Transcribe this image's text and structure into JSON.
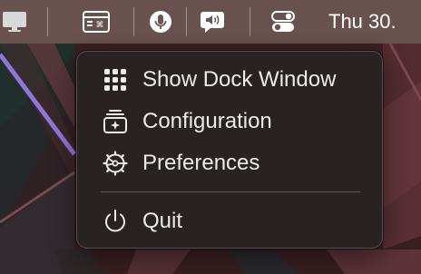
{
  "menubar": {
    "icons": [
      "display-icon",
      "keyboard-shortcut-icon",
      "microphone-icon",
      "speech-bubble-speaker-icon",
      "control-center-toggles-icon"
    ],
    "clock": "Thu 30."
  },
  "menu": {
    "items": [
      {
        "label": "Show Dock Window",
        "icon": "grid-icon"
      },
      {
        "label": "Configuration",
        "icon": "sparkle-stack-icon"
      },
      {
        "label": "Preferences",
        "icon": "gear-icon"
      },
      {
        "label": "Quit",
        "icon": "power-icon"
      }
    ]
  },
  "colors": {
    "menubar": "#6c5654",
    "menu_background": "#282223",
    "text": "#ebebeb",
    "wallpaper_purple": "#8f76d8",
    "wallpaper_green": "#243a33"
  }
}
